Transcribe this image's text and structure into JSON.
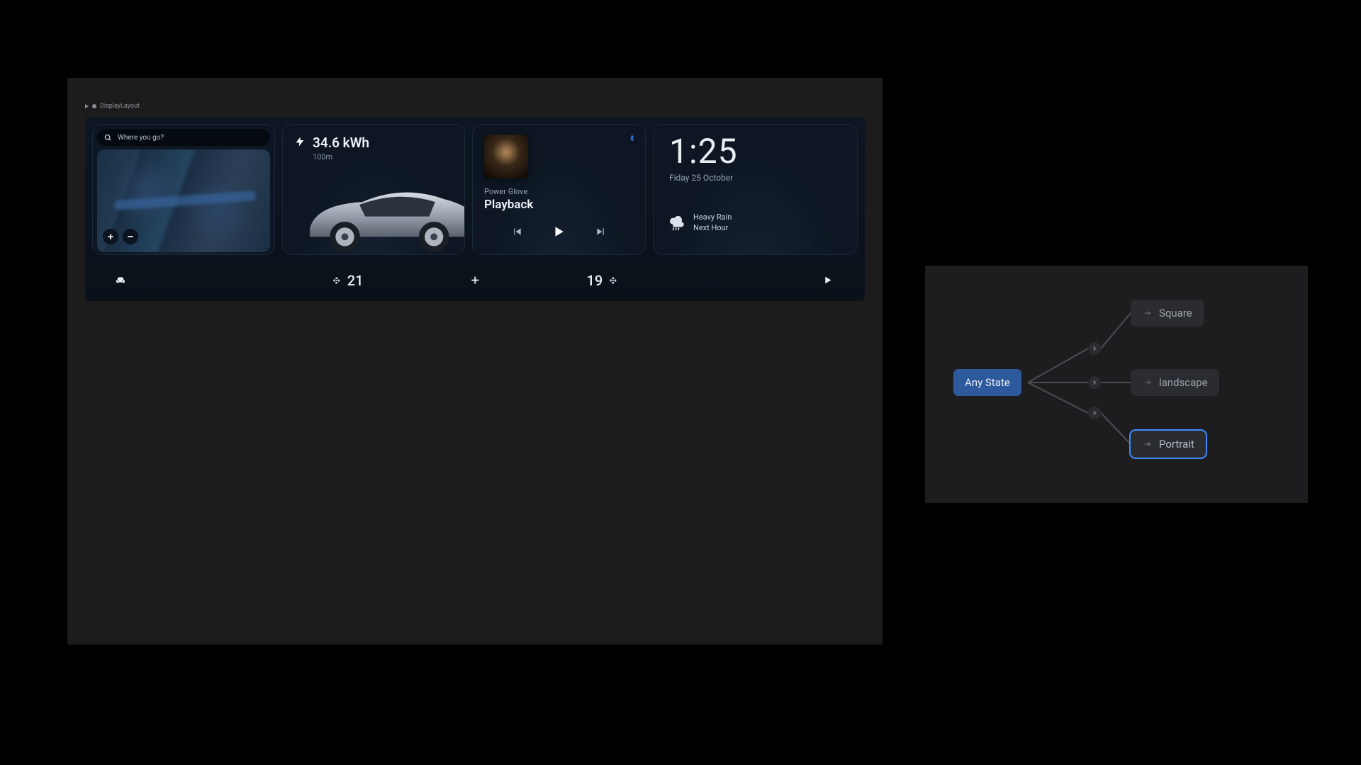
{
  "breadcrumb": {
    "label": "DisplayLayout"
  },
  "map": {
    "search_placeholder": "Where you go?"
  },
  "energy": {
    "value": "34.6 kWh",
    "distance": "100m"
  },
  "media": {
    "artist": "Power Glove",
    "track": "Playback"
  },
  "clock": {
    "time": "1:25",
    "date": "Fiday 25 October"
  },
  "weather": {
    "line1": "Heavy Rain",
    "line2": "Next Hour"
  },
  "climate": {
    "left_temp": "21",
    "right_temp": "19"
  },
  "graph": {
    "root": "Any State",
    "leaves": [
      "Square",
      "landscape",
      "Portrait"
    ],
    "selected_index": 2
  }
}
